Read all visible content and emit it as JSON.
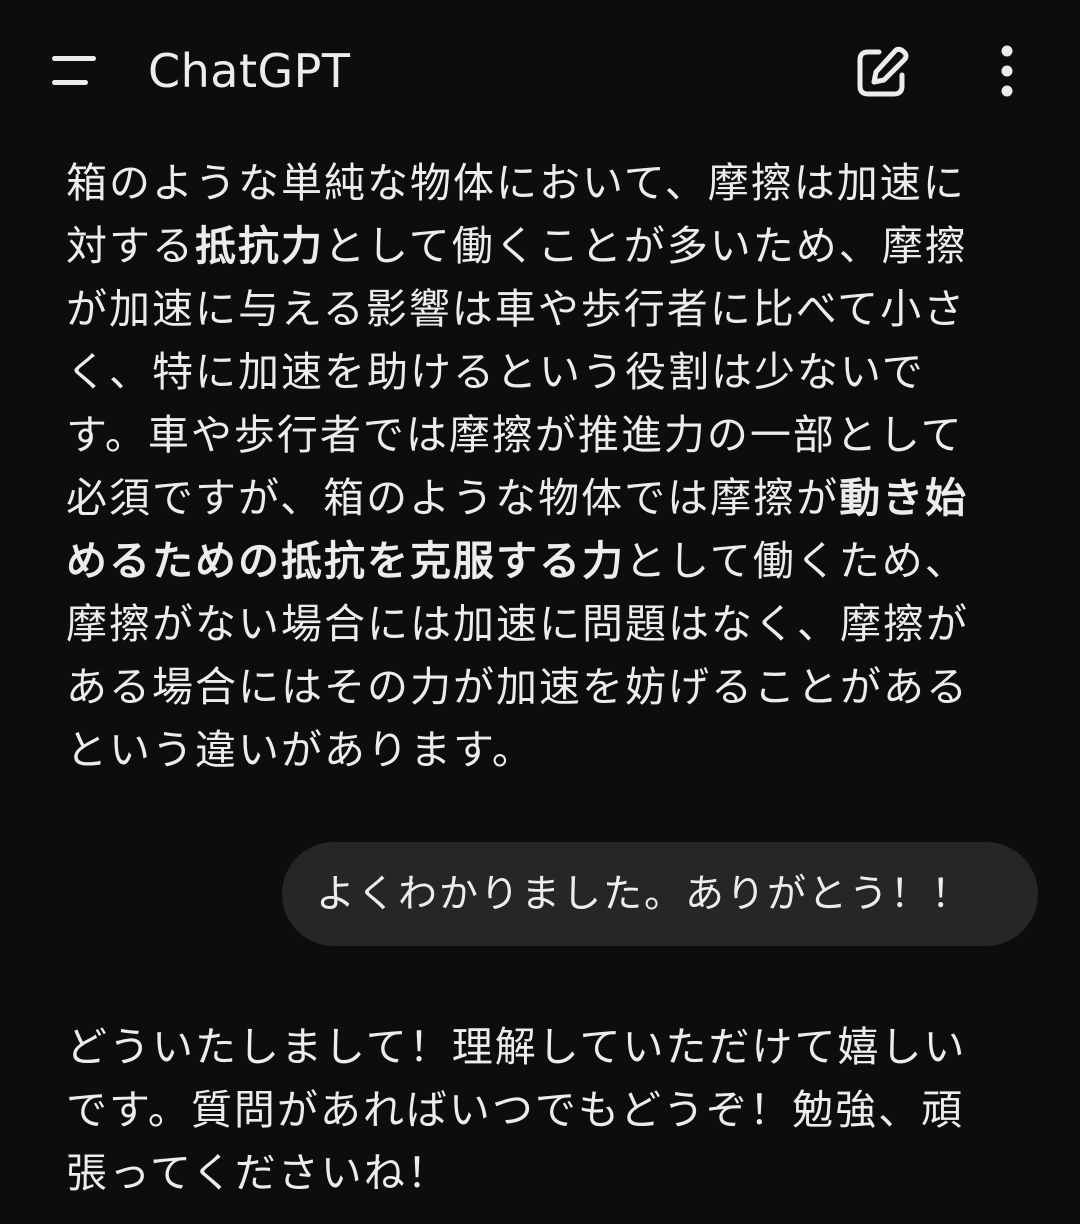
{
  "header": {
    "title": "ChatGPT",
    "menu_icon": "hamburger-menu-icon",
    "new_chat_icon": "new-chat-edit-icon",
    "more_icon": "more-vertical-icon"
  },
  "conversation": {
    "assistant_message_1": {
      "p1": "箱のような単純な物体において、摩擦は加速に対する",
      "b1": "抵抗力",
      "p2": "として働くことが多いため、摩擦が加速に与える影響は車や歩行者に比べて小さく、特に加速を助けるという役割は少ないです。車や歩行者では摩擦が推進力の一部として必須ですが、箱のような物体では摩擦が",
      "b2": "動き始めるための抵抗を克服する力",
      "p3": "として働くため、摩擦がない場合には加速に問題はなく、摩擦がある場合にはその力が加速を妨げることがあるという違いがあります。"
    },
    "user_message": "よくわかりました。ありがとう！！",
    "assistant_message_2": "どういたしまして！理解していただけて嬉しいです。質問があればいつでもどうぞ！勉強、頑張ってくださいね！"
  },
  "colors": {
    "background": "#0d0d0d",
    "text": "#ececec",
    "user_bubble": "#262626"
  }
}
